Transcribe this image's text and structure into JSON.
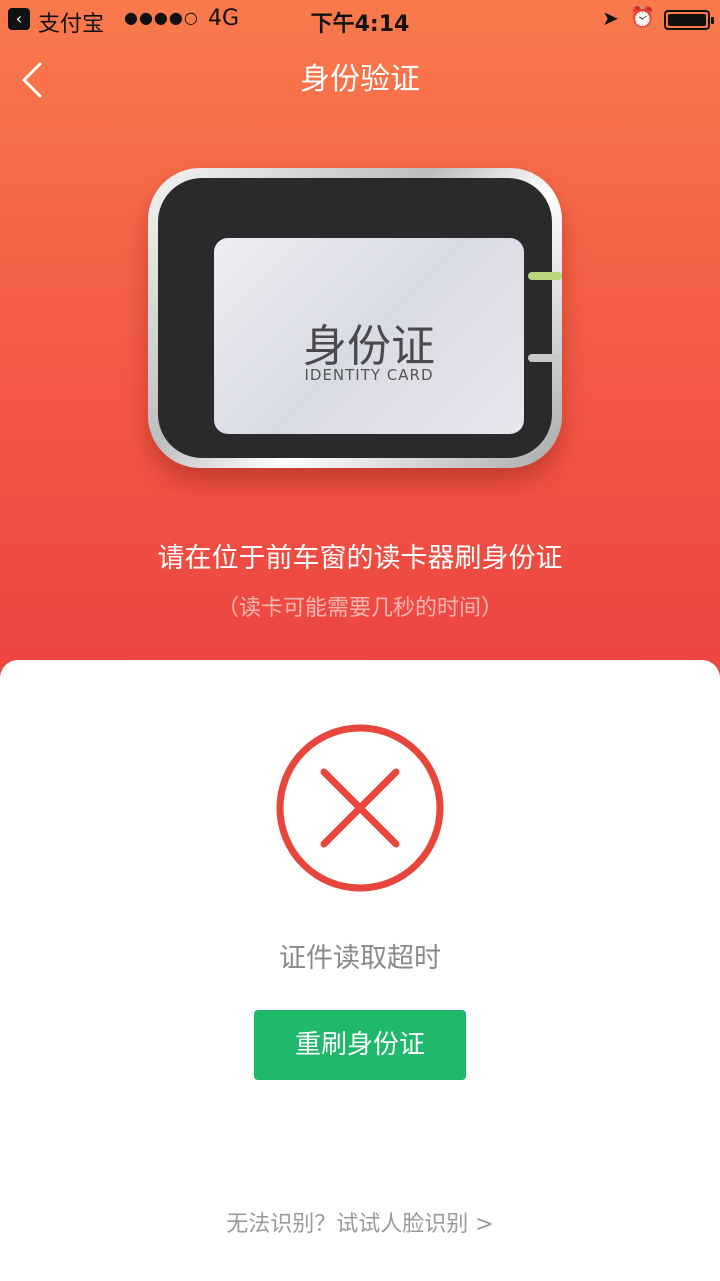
{
  "status_bar": {
    "app_back": "支付宝",
    "signal": "●●●●○",
    "network": "4G",
    "time": "下午4:14"
  },
  "nav": {
    "title": "身份验证"
  },
  "reader": {
    "card_title": "身份证",
    "card_subtitle": "IDENTITY CARD"
  },
  "instruction": "请在位于前车窗的读卡器刷身份证",
  "hint": "（读卡可能需要几秒的时间）",
  "error": {
    "message": "证件读取超时",
    "retry_label": "重刷身份证"
  },
  "face_link": "无法识别？试试人脸识别 >",
  "colors": {
    "header_gradient_top": "#f97a4c",
    "header_gradient_bottom": "#ec4341",
    "error_red": "#e8453c",
    "button_green": "#20b86a"
  }
}
